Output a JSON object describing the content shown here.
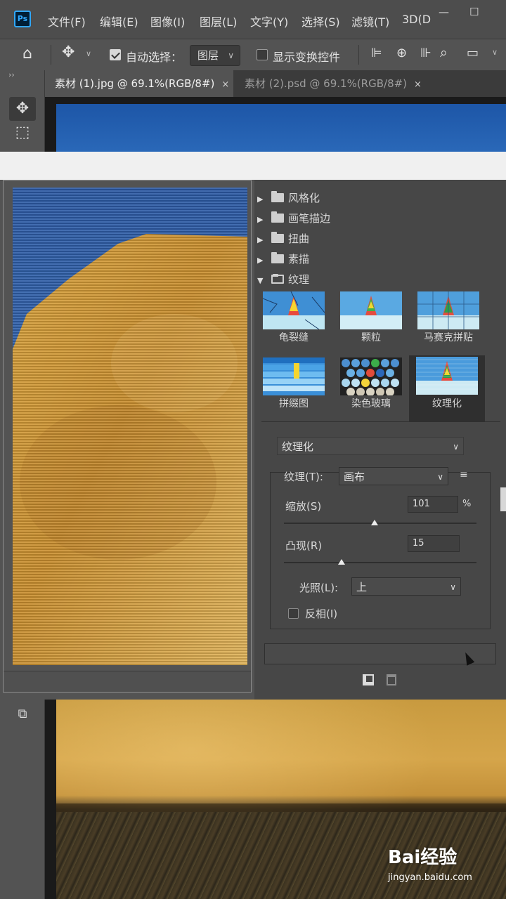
{
  "app": {
    "logo": "Ps",
    "menus": [
      "文件(F)",
      "编辑(E)",
      "图像(I)",
      "图层(L)",
      "文字(Y)",
      "选择(S)",
      "滤镜(T)",
      "3D(D"
    ]
  },
  "options": {
    "auto_select_label": "自动选择：",
    "auto_select_checked": true,
    "auto_select_target": "图层",
    "show_transform_label": "显示变换控件",
    "show_transform_checked": false
  },
  "tabs": [
    {
      "label": "素材 (1).jpg @ 69.1%(RGB/8#)",
      "close": "×",
      "active": true
    },
    {
      "label": "素材 (2).psd @ 69.1%(RGB/8#)",
      "close": "×",
      "active": false
    }
  ],
  "filter_gallery": {
    "categories": [
      {
        "label": "风格化",
        "expanded": false
      },
      {
        "label": "画笔描边",
        "expanded": false
      },
      {
        "label": "扭曲",
        "expanded": false
      },
      {
        "label": "素描",
        "expanded": false
      },
      {
        "label": "纹理",
        "expanded": true
      }
    ],
    "texture_filters": [
      "龟裂缝",
      "颗粒",
      "马赛克拼贴",
      "拼缀图",
      "染色玻璃",
      "纹理化"
    ],
    "selected_filter": "纹理化",
    "settings": {
      "filter_select": "纹理化",
      "texture_label": "纹理(T):",
      "texture_value": "画布",
      "scaling_label": "缩放(S)",
      "scaling_value": "101",
      "scaling_unit": "%",
      "scaling_fraction": 0.47,
      "relief_label": "凸现(R)",
      "relief_value": "15",
      "relief_fraction": 0.3,
      "light_label": "光照(L):",
      "light_value": "上",
      "invert_label": "反相(I)",
      "invert_checked": false
    }
  },
  "watermark": {
    "brand": "Bai经验",
    "url": "jingyan.baidu.com"
  },
  "colors": {
    "ps_blue": "#31a8ff",
    "panel": "#535353",
    "sky": "#2a68b8",
    "rock": "#d5a54a"
  }
}
